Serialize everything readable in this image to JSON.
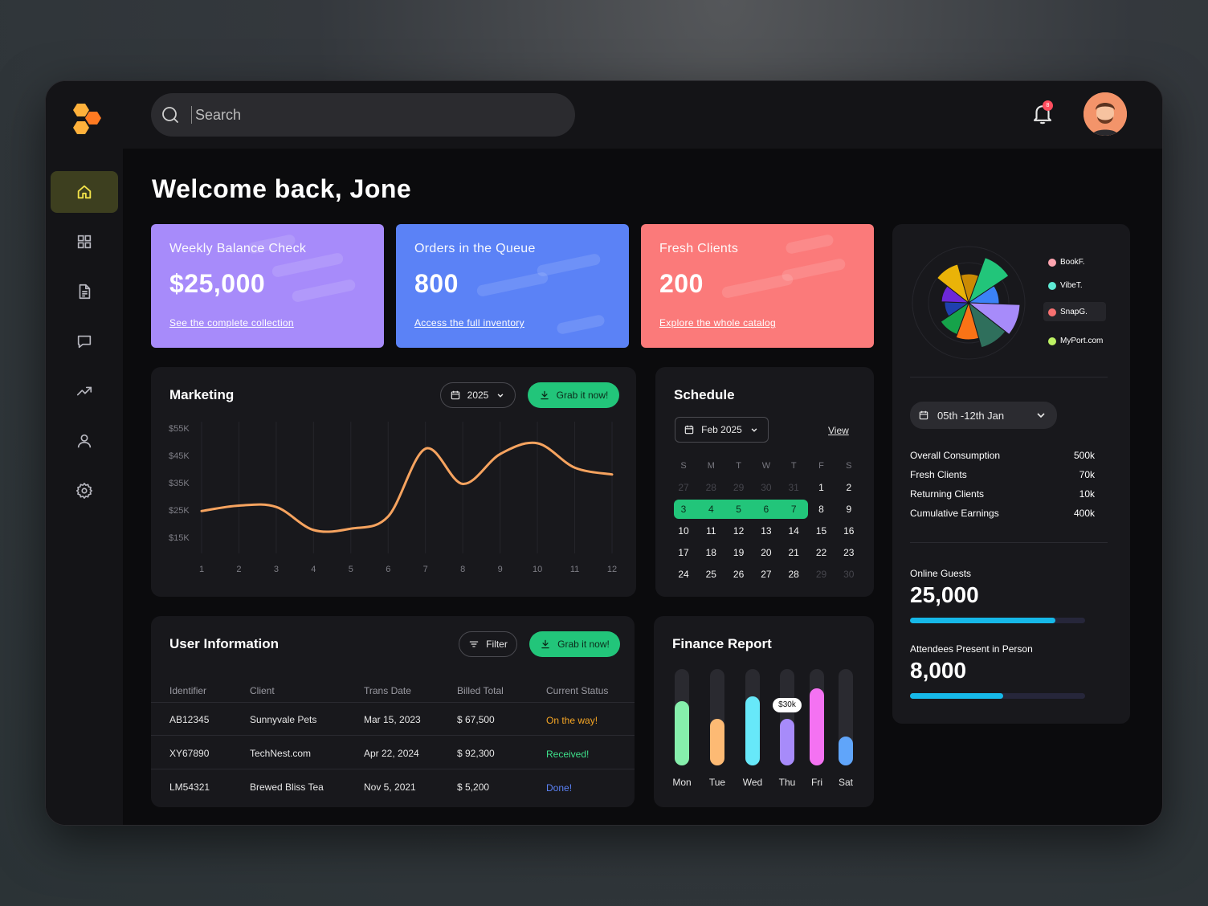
{
  "search": {
    "placeholder": "Search"
  },
  "notifications": {
    "count": "8"
  },
  "welcome": "Welcome back, Jone",
  "stats": [
    {
      "title": "Weekly Balance Check",
      "value": "$25,000",
      "link": "See the complete collection",
      "color": "#a78bfa"
    },
    {
      "title": "Orders in the Queue",
      "value": "800",
      "link": "Access the full inventory",
      "color": "#5b82f6"
    },
    {
      "title": "Fresh Clients",
      "value": "200",
      "link": "Explore the whole catalog",
      "color": "#fb7a7a"
    }
  ],
  "marketing": {
    "title": "Marketing",
    "year": "2025",
    "action": "Grab it now!"
  },
  "chart_data": {
    "type": "line",
    "title": "Marketing",
    "x": [
      1,
      2,
      3,
      4,
      5,
      6,
      7,
      8,
      9,
      10,
      11,
      12
    ],
    "y_ticks": [
      "$55K",
      "$45K",
      "$35K",
      "$25K",
      "$15K"
    ],
    "ylim": [
      15,
      55
    ],
    "series": [
      {
        "values": [
          25,
          27,
          26.5,
          18,
          18.5,
          23,
          48,
          35,
          46,
          50,
          41,
          38.5
        ],
        "color": "#f6a35f"
      }
    ]
  },
  "schedule": {
    "title": "Schedule",
    "month": "Feb 2025",
    "view": "View",
    "weekdays": [
      "S",
      "M",
      "T",
      "W",
      "T",
      "F",
      "S"
    ],
    "weeks": [
      [
        "27",
        "28",
        "29",
        "30",
        "31",
        "1",
        "2"
      ],
      [
        "3",
        "4",
        "5",
        "6",
        "7",
        "8",
        "9"
      ],
      [
        "10",
        "11",
        "12",
        "13",
        "14",
        "15",
        "16"
      ],
      [
        "17",
        "18",
        "19",
        "20",
        "21",
        "22",
        "23"
      ],
      [
        "24",
        "25",
        "26",
        "27",
        "28",
        "29",
        "30"
      ]
    ]
  },
  "users": {
    "title": "User Information",
    "filter": "Filter",
    "action": "Grab it now!",
    "headers": [
      "Identifier",
      "Client",
      "Trans Date",
      "Billed Total",
      "Current Status"
    ],
    "rows": [
      {
        "id": "AB12345",
        "client": "Sunnyvale Pets",
        "date": "Mar 15, 2023",
        "total": "$ 67,500",
        "status": "On the way!",
        "status_color": "#f5a524"
      },
      {
        "id": "XY67890",
        "client": "TechNest.com",
        "date": "Apr 22, 2024",
        "total": "$ 92,300",
        "status": "Received!",
        "status_color": "#3ee08a"
      },
      {
        "id": "LM54321",
        "client": "Brewed Bliss Tea",
        "date": "Nov 5, 2021",
        "total": "$ 5,200",
        "status": "Done!",
        "status_color": "#5b82f6"
      }
    ]
  },
  "finance": {
    "title": "Finance Report",
    "tooltip": "$30k",
    "days": [
      {
        "label": "Mon",
        "level": 0.67,
        "color": "#86efac"
      },
      {
        "label": "Tue",
        "level": 0.48,
        "color": "#fdba74"
      },
      {
        "label": "Wed",
        "level": 0.72,
        "color": "#67e8f9"
      },
      {
        "label": "Thu",
        "level": 0.48,
        "color": "#a78bfa"
      },
      {
        "label": "Fri",
        "level": 0.8,
        "color": "#f472f2"
      },
      {
        "label": "Sat",
        "level": 0.3,
        "color": "#60a5fa"
      }
    ]
  },
  "sidepanel": {
    "legend": [
      {
        "name": "BookF.",
        "color": "#fda4af"
      },
      {
        "name": "VibeT.",
        "color": "#5eead4"
      },
      {
        "name": "SnapG.",
        "color": "#f87171"
      },
      {
        "name": "MyPort.com",
        "color": "#bef264"
      }
    ],
    "range": "05th -12th Jan",
    "stats": [
      {
        "label": "Overall Consumption",
        "value": "500k"
      },
      {
        "label": "Fresh Clients",
        "value": "70k"
      },
      {
        "label": "Returning Clients",
        "value": "10k"
      },
      {
        "label": "Cumulative Earnings",
        "value": "400k"
      }
    ],
    "online_label": "Online Guests",
    "online_value": "25,000",
    "online_progress": 0.83,
    "attend_label": "Attendees Present in Person",
    "attend_value": "8,000",
    "attend_progress": 0.53
  }
}
